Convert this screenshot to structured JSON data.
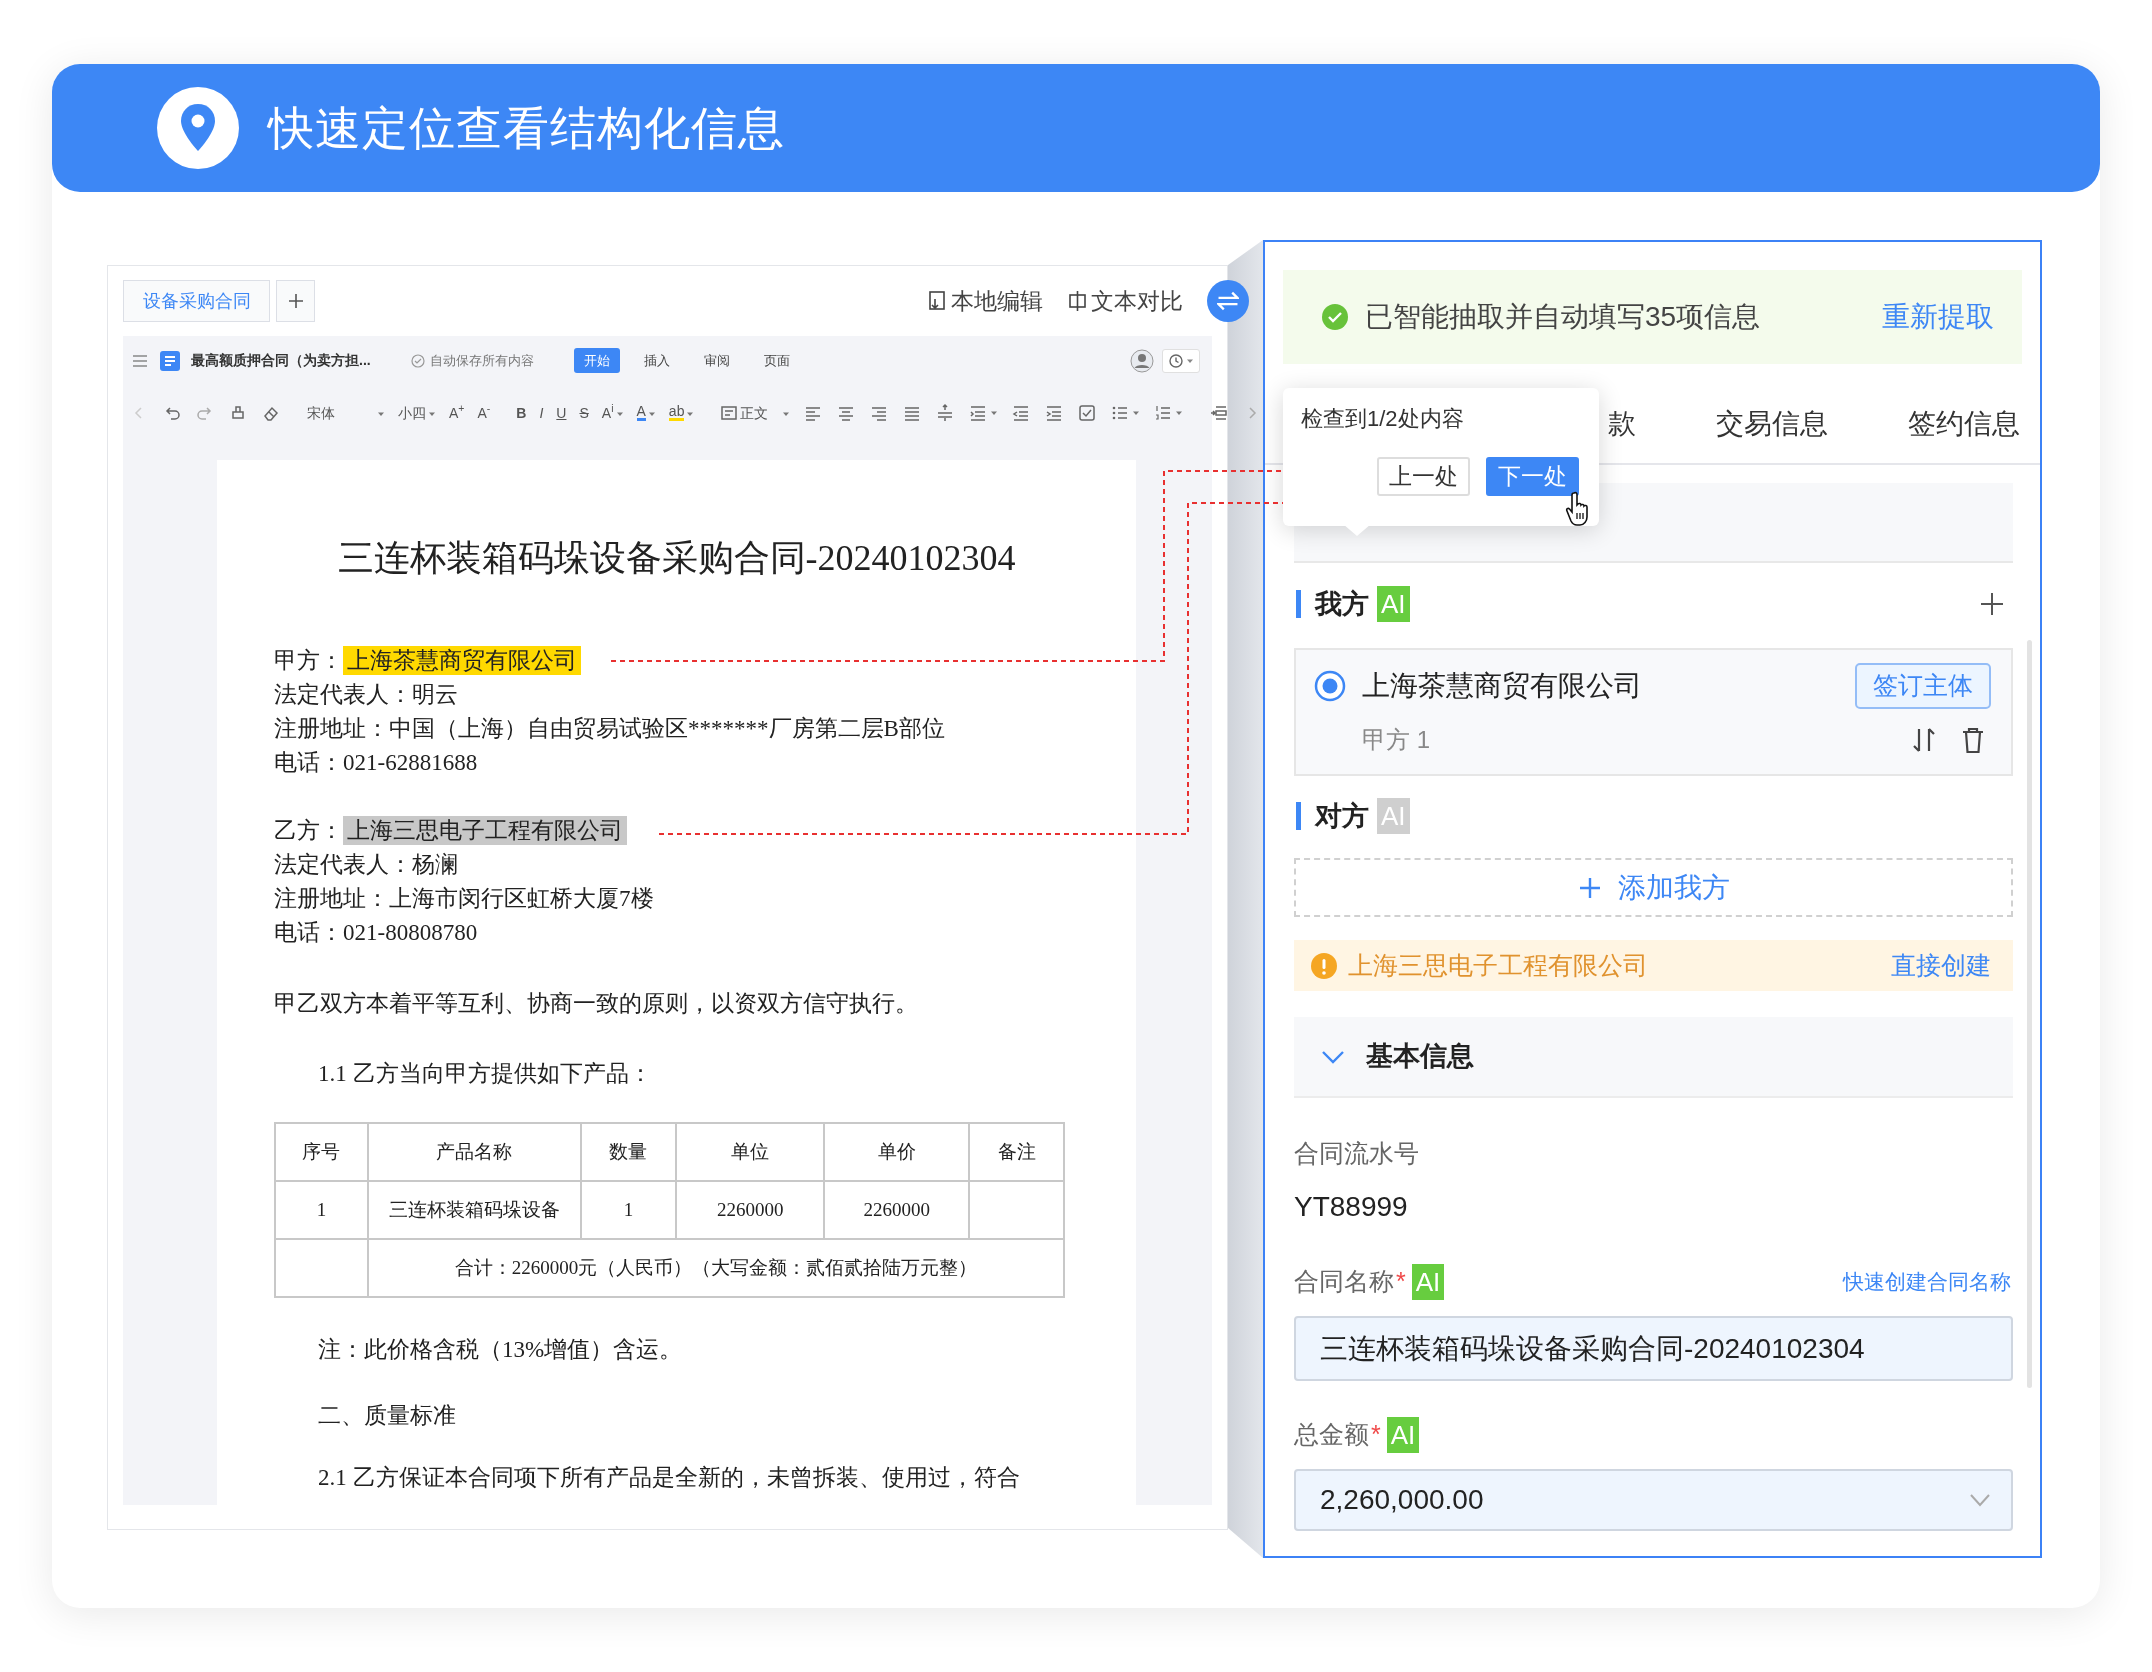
{
  "banner": {
    "title": "快速定位查看结构化信息"
  },
  "editor": {
    "tabs": [
      {
        "label": "设备采购合同",
        "selected": true
      }
    ],
    "actions": [
      "本地编辑",
      "文本对比"
    ],
    "doc_title": "最高额质押合同（为卖方担...",
    "autosave": "自动保存所有内容",
    "ribbon_tabs": [
      {
        "label": "开始",
        "selected": true
      },
      {
        "label": "插入",
        "selected": false
      },
      {
        "label": "审阅",
        "selected": false
      },
      {
        "label": "页面",
        "selected": false
      }
    ],
    "format_toolbar": {
      "font": "宋体",
      "size": "小四",
      "grow": "A$^{+}$",
      "shrink": "A$^{-}$",
      "bold": "B",
      "italic": "I",
      "underline": "U",
      "strike": "S",
      "superscript": "A$^{i}$",
      "font_color": "A",
      "highlight": "ab",
      "paragraph_style": "正文"
    }
  },
  "document": {
    "title": "三连杯装箱码垛设备采购合同-20240102304",
    "parties": [
      {
        "role": "甲方：",
        "name": "上海茶慧商贸有限公司",
        "color": "#ffd900",
        "lines": [
          "法定代表人：明云",
          "注册地址：中国（上海）自由贸易试验区*******厂房第二层B部位",
          "电话：021-62881688"
        ]
      },
      {
        "role": "乙方：",
        "name": "上海三思电子工程有限公司",
        "color": "#c8c8c8",
        "lines": [
          "法定代表人：杨澜",
          "注册地址：上海市闵行区虹桥大厦7楼",
          "电话：021-80808780"
        ]
      }
    ],
    "paragraphs_before": [
      {
        "kind": "lead",
        "text": "甲乙双方本着平等互利、协商一致的原则，以资双方信守执行。"
      },
      {
        "kind": "clause",
        "text": "1.1 乙方当向甲方提供如下产品："
      }
    ],
    "table": {
      "columns": [
        "序号",
        "产品名称",
        "数量",
        "单位",
        "单价",
        "备注"
      ],
      "rows": [
        [
          "1",
          "三连杯装箱码垛设备",
          "1",
          "2260000",
          "2260000"
        ]
      ],
      "total": "合计：2260000元（人民币）（大写金额：贰佰贰拾陆万元整）"
    },
    "paragraphs_after": [
      {
        "kind": "clause",
        "text": "注：此价格含税（13%增值）含运。"
      },
      {
        "kind": "clause",
        "text": "二、质量标准"
      },
      {
        "kind": "clause",
        "text": "2.1 乙方保证本合同项下所有产品是全新的，未曾拆装、使用过，符合"
      }
    ]
  },
  "panel": {
    "extraction": {
      "message": "已智能抽取并自动填写35项信息",
      "action": "重新提取"
    },
    "tabs": [
      {
        "label": "款",
        "selected": false
      },
      {
        "label": "交易信息",
        "selected": false
      },
      {
        "label": "签约信息",
        "selected": false
      }
    ],
    "find_popup": {
      "message": "检查到1/2处内容",
      "buttons": [
        {
          "label": "上一处",
          "kind": "default"
        },
        {
          "label": "下一处",
          "kind": "primary"
        }
      ]
    },
    "our_side": {
      "title": "我方",
      "ai_badge": {
        "label": "AI",
        "active": true
      },
      "parties": [
        {
          "name": "上海茶慧商贸有限公司",
          "selected": true,
          "tag": "签订主体",
          "role": "甲方 1"
        }
      ]
    },
    "counterparty": {
      "title": "对方",
      "ai_badge": {
        "label": "AI",
        "active": false
      },
      "add_button": "添加我方",
      "warning": {
        "name": "上海三思电子工程有限公司",
        "action": "直接创建"
      }
    },
    "basic_info": {
      "title": "基本信息",
      "expanded": true,
      "fields": [
        {
          "kind": "text",
          "label": "合同流水号",
          "value": "YT88999"
        },
        {
          "kind": "input",
          "label": "合同名称",
          "required_mark": "*",
          "ai_badge": {
            "label": "AI",
            "active": true
          },
          "link": "快速创建合同名称",
          "value": "三连杯装箱码垛设备采购合同-20240102304"
        },
        {
          "kind": "select",
          "label": "总金额",
          "required_mark": "*",
          "ai_badge": {
            "label": "AI",
            "active": true
          },
          "value": "2,260,000.00"
        }
      ]
    }
  }
}
